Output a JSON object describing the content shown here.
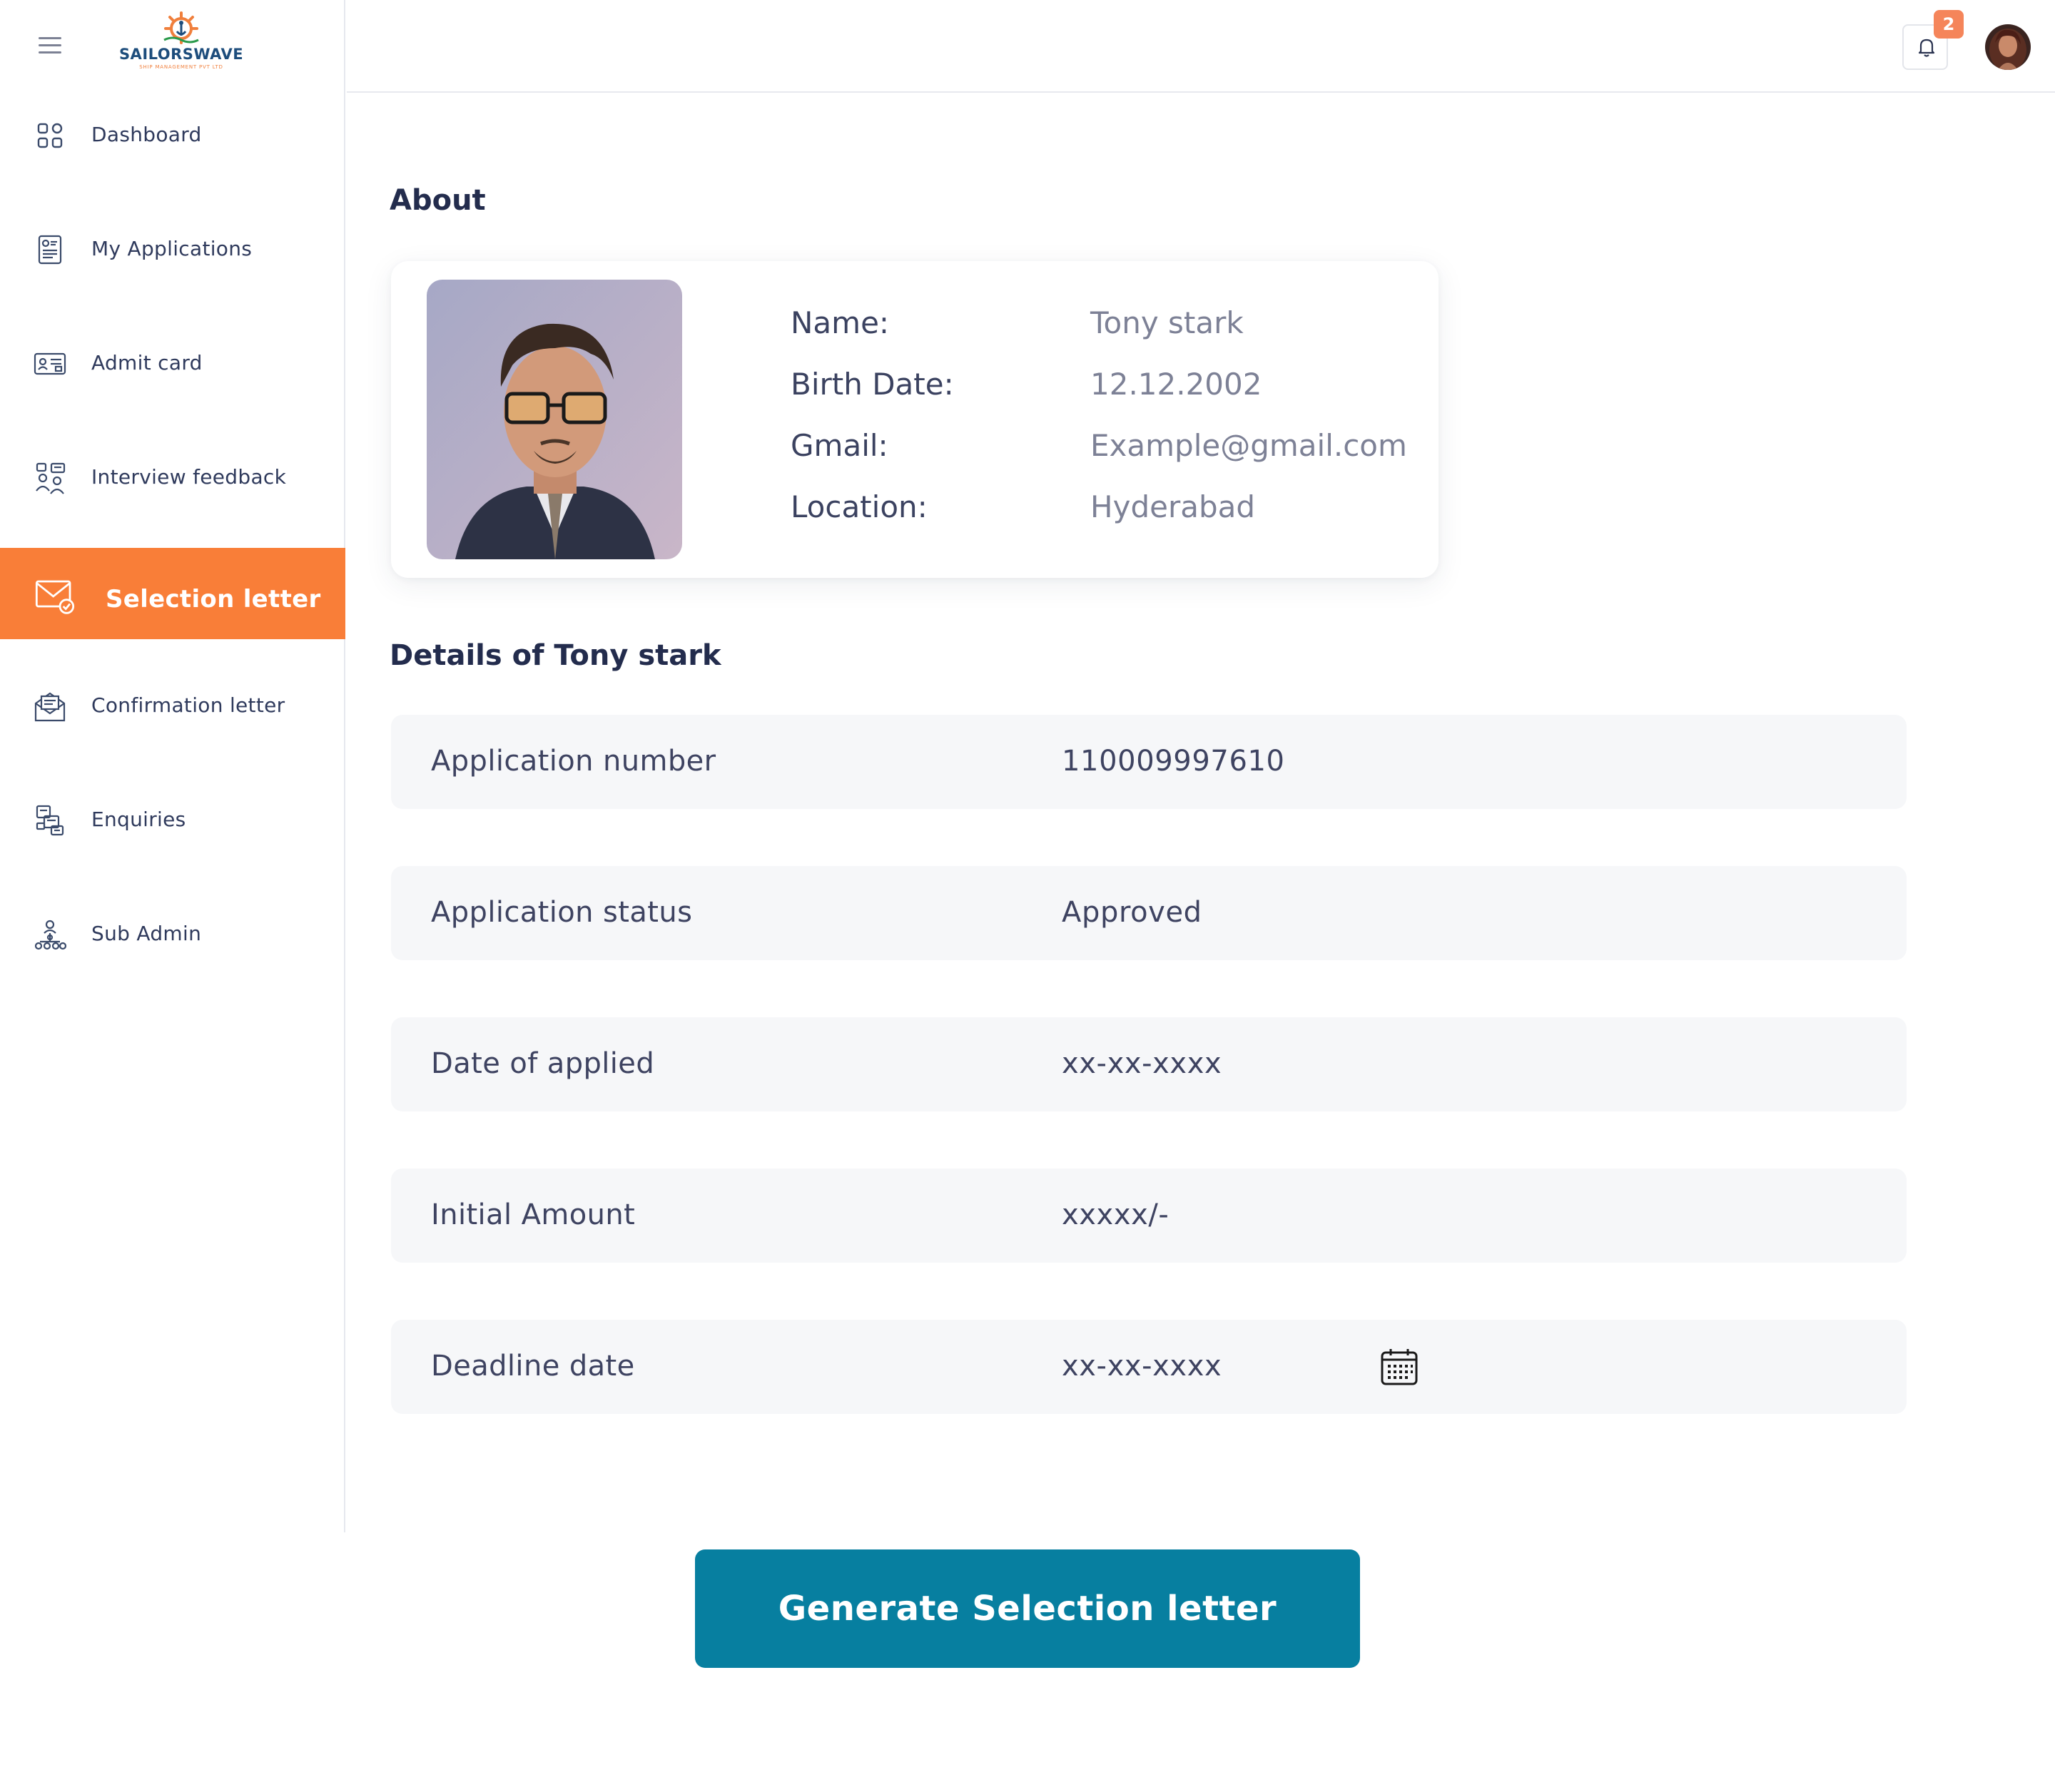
{
  "brand": {
    "name": "SAILORSWAVE",
    "tagline": "SHIP MANAGEMENT PVT LTD"
  },
  "sidebar": {
    "items": [
      {
        "label": "Dashboard",
        "icon": "dashboard-icon",
        "active": false
      },
      {
        "label": "My Applications",
        "icon": "applications-icon",
        "active": false
      },
      {
        "label": "Admit card",
        "icon": "admit-card-icon",
        "active": false
      },
      {
        "label": "Interview feedback",
        "icon": "interview-feedback-icon",
        "active": false
      },
      {
        "label": "Selection letter",
        "icon": "envelope-check-icon",
        "active": true
      },
      {
        "label": "Confirmation letter",
        "icon": "mail-open-icon",
        "active": false
      },
      {
        "label": "Enquiries",
        "icon": "enquiries-icon",
        "active": false
      },
      {
        "label": "Sub Admin",
        "icon": "sub-admin-icon",
        "active": false
      }
    ]
  },
  "header": {
    "notification_count": "2"
  },
  "about": {
    "title": "About",
    "fields": [
      {
        "label": "Name:",
        "value": "Tony stark"
      },
      {
        "label": "Birth Date:",
        "value": "12.12.2002"
      },
      {
        "label": "Gmail:",
        "value": "Example@gmail.com"
      },
      {
        "label": "Location:",
        "value": "Hyderabad"
      }
    ]
  },
  "details": {
    "title": "Details of Tony stark",
    "rows": [
      {
        "label": "Application number",
        "value": "110009997610"
      },
      {
        "label": "Application status",
        "value": "Approved"
      },
      {
        "label": "Date of applied",
        "value": "xx-xx-xxxx"
      },
      {
        "label": "Initial Amount",
        "value": "xxxxx/-"
      },
      {
        "label": "Deadline date",
        "value": "xx-xx-xxxx"
      }
    ]
  },
  "actions": {
    "generate_label": "Generate Selection letter"
  },
  "colors": {
    "accent": "#f97e38",
    "primary_button": "#077fa0",
    "row_bg": "#f6f7f9",
    "text_dark": "#232c4d"
  }
}
